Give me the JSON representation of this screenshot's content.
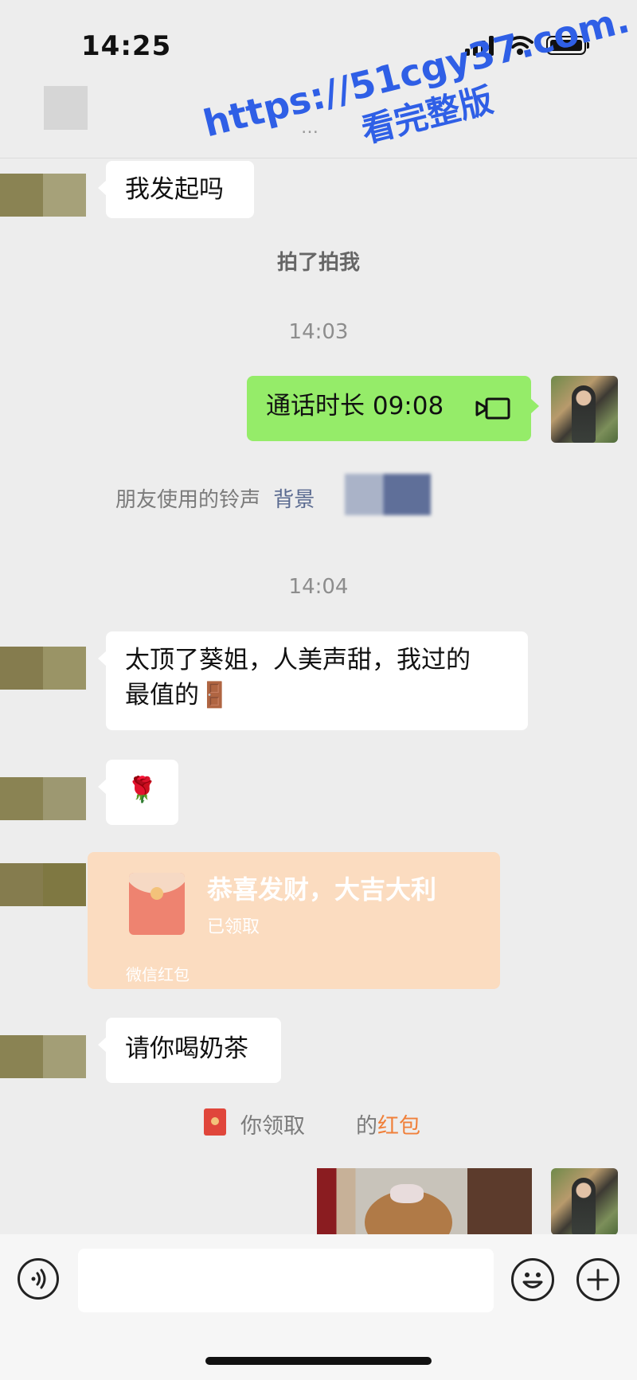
{
  "status_bar": {
    "time": "14:25",
    "icons": [
      "signal-icon",
      "wifi-icon",
      "battery-icon"
    ]
  },
  "header": {
    "title_dots": "…"
  },
  "watermark": {
    "url": "https://51cgy37.com.",
    "tagline": "看完整版"
  },
  "messages": [
    {
      "side": "left",
      "text": "我发起吗"
    },
    {
      "type": "system",
      "text": "拍了拍我"
    },
    {
      "type": "time",
      "text": "14:03"
    },
    {
      "side": "right",
      "type": "call",
      "label": "通话时长 09:08",
      "icon": "video-call-icon"
    },
    {
      "type": "ringtone",
      "prefix": "朋友使用的铃声",
      "link": "背景"
    },
    {
      "type": "time",
      "text": "14:04"
    },
    {
      "side": "left",
      "line1": "太顶了葵姐，人美声甜，我过的",
      "line2": "最值的",
      "emoji": "🚪"
    },
    {
      "side": "left",
      "emoji": "🌹"
    },
    {
      "side": "left",
      "type": "red_packet",
      "title": "恭喜发财，大吉大利",
      "status": "已领取",
      "footer": "微信红包"
    },
    {
      "side": "left",
      "text": "请你喝奶茶"
    },
    {
      "type": "system_red_packet",
      "prefix": "你领取",
      "suffix": "的",
      "link": "红包"
    },
    {
      "side": "right",
      "type": "image"
    }
  ],
  "input_bar": {
    "placeholder": "",
    "icons": [
      "voice-icon",
      "emoji-icon",
      "plus-icon"
    ]
  },
  "colors": {
    "accent_green": "#95ec69",
    "red_packet_bg": "#fbdcc0",
    "watermark_blue": "#2f5fe6",
    "link_orange": "#f0803a",
    "link_blue": "#5a6a90"
  }
}
